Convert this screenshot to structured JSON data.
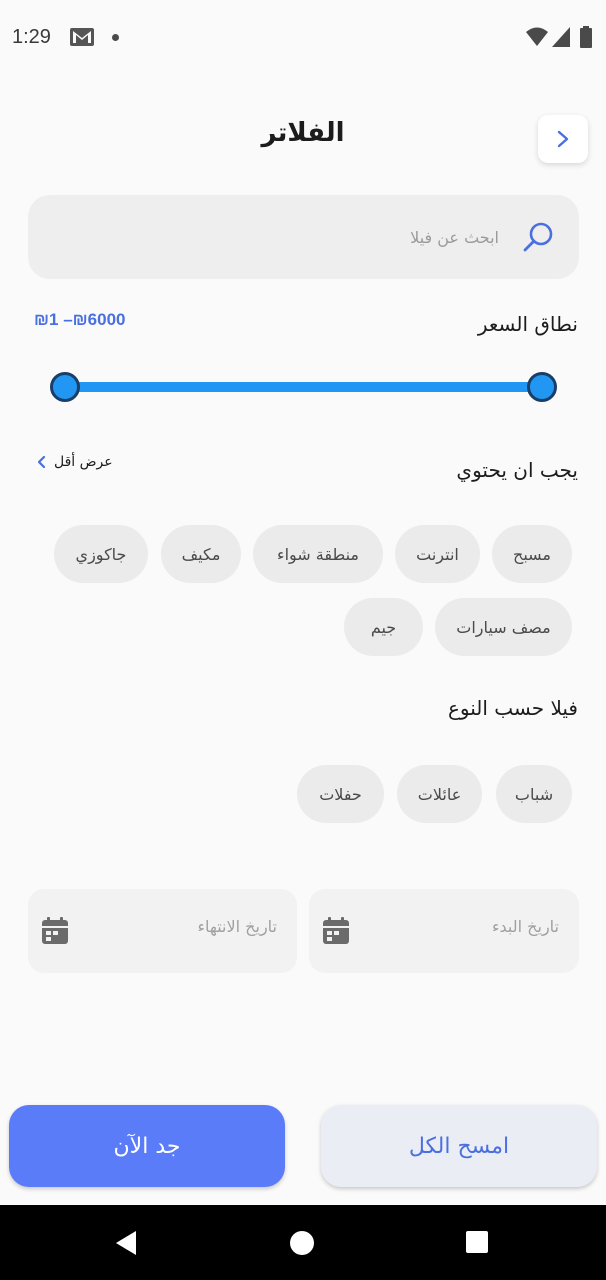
{
  "status_bar": {
    "time": "1:29"
  },
  "header": {
    "title": "الفلاتر"
  },
  "search": {
    "placeholder": "ابحث عن فيلا"
  },
  "price": {
    "label": "نطاق السعر",
    "value": "₪1 –₪6000",
    "min_fraction": 0.0,
    "max_fraction": 1.0
  },
  "amenities": {
    "title": "يجب ان يحتوي",
    "show_less": "عرض أقل",
    "items": [
      "مسبح",
      "انترنت",
      "منطقة  شواء",
      "مكيف",
      "جاكوزي",
      "مصف سيارات",
      "جيم"
    ]
  },
  "villa_types": {
    "title": "فيلا حسب النوع",
    "items": [
      "شباب",
      "عائلات",
      "حفلات"
    ]
  },
  "dates": {
    "start_label": "تاريخ البدء",
    "end_label": "تاريخ الانتهاء"
  },
  "actions": {
    "find_now": "جد الآن",
    "clear_all": "امسح الكل"
  },
  "colors": {
    "accent": "#5a7cf9",
    "slider": "#2196f3",
    "chip_bg": "#ebebeb"
  }
}
